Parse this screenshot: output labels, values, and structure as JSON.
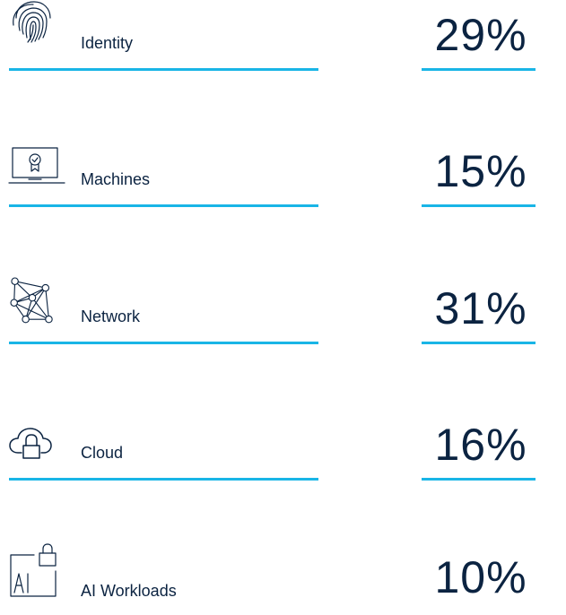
{
  "accent_color": "#19b5e6",
  "text_color": "#0b2341",
  "categories": [
    {
      "label": "Identity",
      "percent": "29%",
      "value": 29,
      "icon": "fingerprint-icon"
    },
    {
      "label": "Machines",
      "percent": "15%",
      "value": 15,
      "icon": "laptop-certificate-icon"
    },
    {
      "label": "Network",
      "percent": "31%",
      "value": 31,
      "icon": "network-nodes-icon"
    },
    {
      "label": "Cloud",
      "percent": "16%",
      "value": 16,
      "icon": "cloud-lock-icon"
    },
    {
      "label": "AI Workloads",
      "percent": "10%",
      "value": 10,
      "icon": "ai-lock-icon"
    }
  ]
}
